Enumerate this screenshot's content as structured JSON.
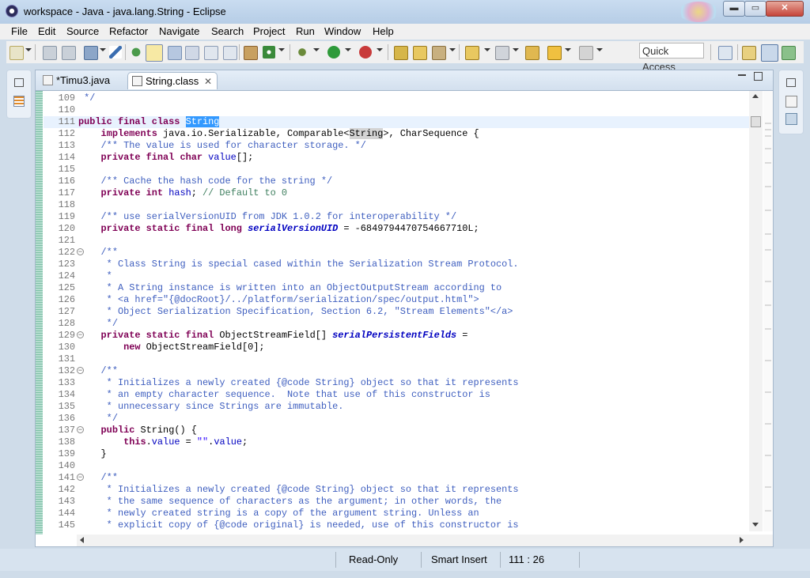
{
  "window": {
    "title": "workspace - Java - java.lang.String - Eclipse",
    "min_label": "▬",
    "max_label": "▭",
    "close_label": "✕"
  },
  "menu": [
    "File",
    "Edit",
    "Source",
    "Refactor",
    "Navigate",
    "Search",
    "Project",
    "Run",
    "Window",
    "Help"
  ],
  "toolbar": {
    "quick_access": "Quick Access"
  },
  "tabs": [
    {
      "label": "*Timu3.java",
      "icon": "java-file-icon"
    },
    {
      "label": "String.class",
      "icon": "class-file-icon",
      "close": "✕"
    }
  ],
  "editor": {
    "first_line": 109,
    "lines": [
      {
        "n": "109",
        "t": " */",
        "c": "cm"
      },
      {
        "n": "110",
        "t": "",
        "c": ""
      },
      {
        "n": "111",
        "h": "<span class=\"kw\">public final class</span> <span class=\"sel\">String</span>",
        "cur": true
      },
      {
        "n": "112",
        "h": "    <span class=\"kw\">implements</span> java.io.Serializable, Comparable&lt;<span class=\"occ\">String</span>&gt;, CharSequence {"
      },
      {
        "n": "113",
        "t": "    /** The value is used for character storage. */",
        "c": "cm"
      },
      {
        "n": "114",
        "h": "    <span class=\"kw\">private final char</span> <span class=\"fld\">value</span>[];"
      },
      {
        "n": "115",
        "t": "",
        "c": ""
      },
      {
        "n": "116",
        "t": "    /** Cache the hash code for the string */",
        "c": "cm"
      },
      {
        "n": "117",
        "h": "    <span class=\"kw\">private int</span> <span class=\"fld\">hash</span>; <span class=\"lc\">// Default to 0</span>"
      },
      {
        "n": "118",
        "t": "",
        "c": ""
      },
      {
        "n": "119",
        "t": "    /** use serialVersionUID from JDK 1.0.2 for interoperability */",
        "c": "cm"
      },
      {
        "n": "120",
        "h": "    <span class=\"kw\">private static final long</span> <span class=\"sfld\">serialVersionUID</span> = -6849794470754667710L;"
      },
      {
        "n": "121",
        "t": "",
        "c": ""
      },
      {
        "n": "122",
        "t": "    /**",
        "c": "cm",
        "fold": true
      },
      {
        "n": "123",
        "t": "     * Class String is special cased within the Serialization Stream Protocol.",
        "c": "cm"
      },
      {
        "n": "124",
        "t": "     *",
        "c": "cm"
      },
      {
        "n": "125",
        "t": "     * A String instance is written into an ObjectOutputStream according to",
        "c": "cm"
      },
      {
        "n": "126",
        "t": "     * <a href=\"{@docRoot}/../platform/serialization/spec/output.html\">",
        "c": "cm"
      },
      {
        "n": "127",
        "t": "     * Object Serialization Specification, Section 6.2, \"Stream Elements\"</a>",
        "c": "cm"
      },
      {
        "n": "128",
        "t": "     */",
        "c": "cm"
      },
      {
        "n": "129",
        "h": "    <span class=\"kw\">private static final</span> ObjectStreamField[] <span class=\"sfld\">serialPersistentFields</span> =",
        "fold": true
      },
      {
        "n": "130",
        "h": "        <span class=\"kw\">new</span> ObjectStreamField[0];"
      },
      {
        "n": "131",
        "t": "",
        "c": ""
      },
      {
        "n": "132",
        "t": "    /**",
        "c": "cm",
        "fold": true
      },
      {
        "n": "133",
        "t": "     * Initializes a newly created {@code String} object so that it represents",
        "c": "cm"
      },
      {
        "n": "134",
        "t": "     * an empty character sequence.  Note that use of this constructor is",
        "c": "cm"
      },
      {
        "n": "135",
        "t": "     * unnecessary since Strings are immutable.",
        "c": "cm"
      },
      {
        "n": "136",
        "t": "     */",
        "c": "cm"
      },
      {
        "n": "137",
        "h": "    <span class=\"kw\">public</span> String() {",
        "fold": true
      },
      {
        "n": "138",
        "h": "        <span class=\"kw\">this</span>.<span class=\"fld\">value</span> = <span class=\"str\">\"\"</span>.<span class=\"fld\">value</span>;"
      },
      {
        "n": "139",
        "t": "    }",
        "c": ""
      },
      {
        "n": "140",
        "t": "",
        "c": ""
      },
      {
        "n": "141",
        "t": "    /**",
        "c": "cm",
        "fold": true
      },
      {
        "n": "142",
        "t": "     * Initializes a newly created {@code String} object so that it represents",
        "c": "cm"
      },
      {
        "n": "143",
        "t": "     * the same sequence of characters as the argument; in other words, the",
        "c": "cm"
      },
      {
        "n": "144",
        "t": "     * newly created string is a copy of the argument string. Unless an",
        "c": "cm"
      },
      {
        "n": "145",
        "t": "     * explicit copy of {@code original} is needed, use of this constructor is",
        "c": "cm"
      }
    ]
  },
  "status": {
    "mode": "Read-Only",
    "insert": "Smart Insert",
    "position": "111 : 26"
  }
}
